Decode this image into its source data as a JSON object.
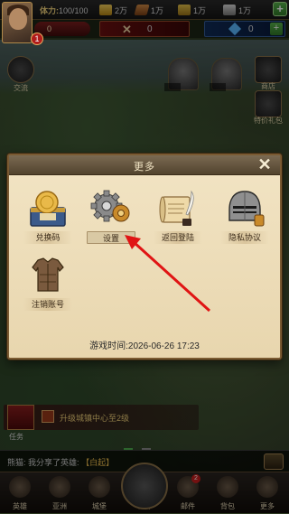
{
  "top_bar": {
    "stamina_label": "体力:",
    "stamina_value": "100/100",
    "resources": [
      {
        "name": "gold",
        "value": "2万"
      },
      {
        "name": "wood",
        "value": "1万"
      },
      {
        "name": "food",
        "value": "1万"
      },
      {
        "name": "iron",
        "value": "1万"
      }
    ],
    "avatar_badge": "1",
    "power_value": "0",
    "battle_value": "0",
    "gems_value": "0"
  },
  "side": {
    "left_icon_label": "交流",
    "right_icon_1_label": "商店",
    "right_icon_2_label": "特价礼包"
  },
  "modal": {
    "title": "更多",
    "close_symbol": "✕",
    "items": [
      {
        "label": "兑换码"
      },
      {
        "label": "设置"
      },
      {
        "label": "返回登陆"
      },
      {
        "label": "隐私协议"
      },
      {
        "label": "注销账号"
      }
    ],
    "playtime_label": "游戏时间:",
    "playtime_value": "2026-06-26 17:23"
  },
  "quest": {
    "text": "升级城镇中心至2级",
    "label": "任务"
  },
  "chat": {
    "sender": "熊猫:",
    "message": "我分享了英雄:",
    "tag": "【白起】"
  },
  "navbar": {
    "items": [
      {
        "label": "英雄",
        "icon": "helmet-icon"
      },
      {
        "label": "亚洲",
        "icon": "shield-icon"
      },
      {
        "label": "城堡",
        "icon": "castle-icon"
      },
      {
        "label": "世界",
        "icon": "globe-icon"
      },
      {
        "label": "邮件",
        "icon": "mail-icon",
        "badge": "2"
      },
      {
        "label": "背包",
        "icon": "backpack-icon"
      },
      {
        "label": "更多",
        "icon": "more-icon"
      }
    ]
  },
  "colors": {
    "modal_bg": "#f2e4c4",
    "modal_header": "#52432e",
    "arrow": "#e01414",
    "accent_gold": "#f1d27a"
  }
}
